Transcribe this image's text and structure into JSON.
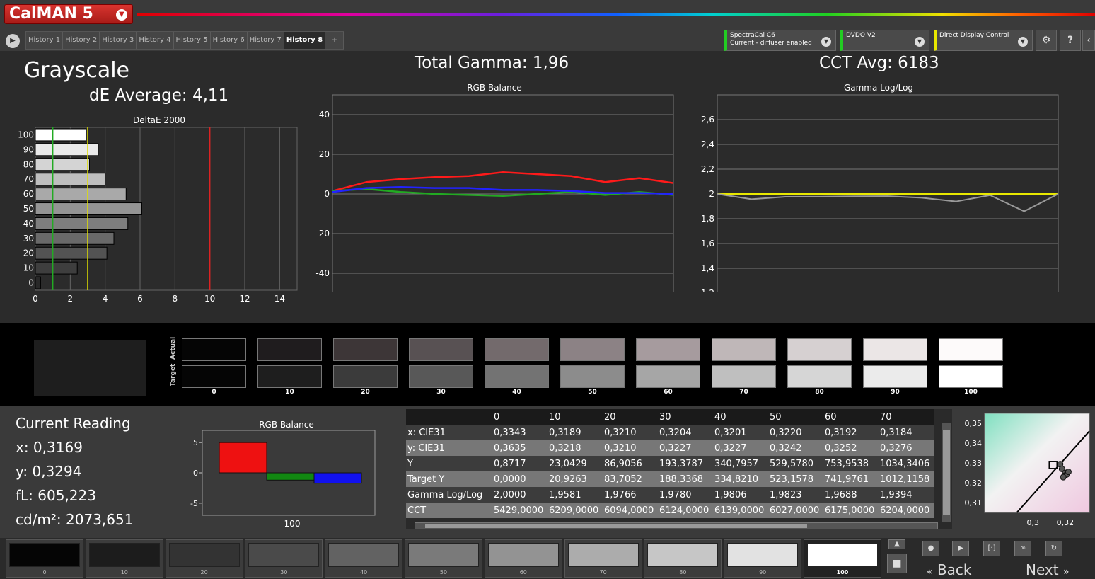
{
  "app": {
    "logo_text": "CalMAN 5"
  },
  "tabs": [
    {
      "label": "History 1"
    },
    {
      "label": "History 2"
    },
    {
      "label": "History 3"
    },
    {
      "label": "History 4"
    },
    {
      "label": "History 5"
    },
    {
      "label": "History 6"
    },
    {
      "label": "History 7"
    },
    {
      "label": "History 8",
      "active": true
    }
  ],
  "tab_add_label": "+",
  "devices": {
    "meter_line1": "SpectraCal C6",
    "meter_line2": "Current - diffuser enabled",
    "source": "DVDO V2",
    "display": "Direct Display Control"
  },
  "header": {
    "title": "Grayscale",
    "de_average": "dE Average: 4,11",
    "total_gamma": "Total Gamma: 1,96",
    "cct_avg": "CCT Avg: 6183"
  },
  "chart_data": [
    {
      "type": "bar",
      "title": "DeltaE 2000",
      "orientation": "horizontal",
      "categories": [
        "0",
        "10",
        "20",
        "30",
        "40",
        "50",
        "60",
        "70",
        "80",
        "90",
        "100"
      ],
      "values": [
        0.3,
        2.4,
        4.1,
        4.5,
        5.3,
        6.1,
        5.2,
        4.0,
        3.1,
        3.6,
        2.9
      ],
      "xlim": [
        0,
        15
      ],
      "xticks": [
        0,
        2,
        4,
        6,
        8,
        10,
        12,
        14
      ],
      "reference_lines": [
        {
          "value": 1,
          "color": "#22aa22"
        },
        {
          "value": 3,
          "color": "#e0e000"
        },
        {
          "value": 10,
          "color": "#dd2222"
        }
      ]
    },
    {
      "type": "line",
      "title": "RGB Balance",
      "x": [
        0,
        10,
        20,
        30,
        40,
        50,
        60,
        70,
        80,
        90,
        100
      ],
      "ylim": [
        -50,
        50
      ],
      "yticks": [
        40,
        20,
        0,
        -20,
        -40
      ],
      "series": [
        {
          "color": "#ff1a1a",
          "values": [
            1.5,
            6.0,
            7.5,
            8.5,
            9.0,
            11.0,
            10.0,
            9.0,
            6.0,
            8.0,
            5.5
          ]
        },
        {
          "color": "#22aa22",
          "values": [
            1.5,
            2.5,
            1.0,
            0.0,
            -0.5,
            -1.0,
            0.0,
            1.0,
            -0.5,
            1.0,
            -0.5
          ]
        },
        {
          "color": "#2222ff",
          "values": [
            1.0,
            3.0,
            3.5,
            3.0,
            3.0,
            2.0,
            2.0,
            1.5,
            0.5,
            0.5,
            0.0
          ]
        }
      ]
    },
    {
      "type": "line",
      "title": "Gamma Log/Log",
      "x": [
        0,
        10,
        20,
        30,
        40,
        50,
        60,
        70,
        80,
        90,
        100
      ],
      "ylim": [
        1.2,
        2.8
      ],
      "yticks": [
        "2,6",
        "2,4",
        "2,2",
        "2",
        "1,8",
        "1,6",
        "1,4",
        "1,2"
      ],
      "ytick_values": [
        2.6,
        2.4,
        2.2,
        2.0,
        1.8,
        1.6,
        1.4,
        1.2
      ],
      "series": [
        {
          "color": "#e8e800",
          "values": [
            2.0,
            2.0,
            2.0,
            2.0,
            2.0,
            2.0,
            2.0,
            2.0,
            2.0,
            2.0,
            2.0
          ]
        },
        {
          "color": "#9a9a9a",
          "values": [
            2.0,
            1.958,
            1.977,
            1.978,
            1.981,
            1.982,
            1.969,
            1.939,
            1.99,
            1.86,
            2.0
          ]
        }
      ]
    },
    {
      "type": "bar",
      "title": "RGB Balance",
      "categories": [
        "100"
      ],
      "series": [
        {
          "color": "#ee1111",
          "values": [
            5.0
          ]
        },
        {
          "color": "#118811",
          "values": [
            -1.2
          ]
        },
        {
          "color": "#1111ee",
          "values": [
            -1.7
          ]
        }
      ],
      "ylim": [
        -7,
        7
      ],
      "yticks": [
        5,
        0,
        -5
      ]
    },
    {
      "type": "scatter",
      "xticks": [
        "0,3",
        "0,32"
      ],
      "yticks": [
        "0,35",
        "0,34",
        "0,33",
        "0,32",
        "0,31"
      ],
      "xlim": [
        0.27,
        0.335
      ],
      "ylim": [
        0.305,
        0.355
      ],
      "target": {
        "x": 0.3127,
        "y": 0.329
      },
      "points": [
        {
          "x": 0.3169,
          "y": 0.3294
        },
        {
          "x": 0.318,
          "y": 0.327
        },
        {
          "x": 0.32,
          "y": 0.325
        },
        {
          "x": 0.3195,
          "y": 0.3235
        },
        {
          "x": 0.321,
          "y": 0.3242
        },
        {
          "x": 0.3188,
          "y": 0.3228
        },
        {
          "x": 0.322,
          "y": 0.3255
        }
      ]
    }
  ],
  "swatches": {
    "labels": [
      "0",
      "10",
      "20",
      "30",
      "40",
      "50",
      "60",
      "70",
      "80",
      "90",
      "100"
    ],
    "actual_label": "Actual",
    "target_label": "Target",
    "actual_colors": [
      "#050505",
      "#1f1c1e",
      "#3d3637",
      "#585153",
      "#736a6c",
      "#8c8285",
      "#a69b9e",
      "#bfb7b8",
      "#d6d0d1",
      "#ebe6e6",
      "#fdfafa"
    ],
    "target_colors": [
      "#050505",
      "#1e1e1e",
      "#3b3b3b",
      "#585858",
      "#737373",
      "#8c8c8c",
      "#a6a6a6",
      "#bfbfbf",
      "#d6d6d6",
      "#ebebeb",
      "#ffffff"
    ]
  },
  "current_reading": {
    "title": "Current Reading",
    "x": "x: 0,3169",
    "y": "y: 0,3294",
    "fl": "fL: 605,223",
    "cdm2": "cd/m²: 2073,651"
  },
  "table": {
    "columns": [
      "0",
      "10",
      "20",
      "30",
      "40",
      "50",
      "60",
      "70"
    ],
    "rows": [
      {
        "label": "x: CIE31",
        "values": [
          "0,3343",
          "0,3189",
          "0,3210",
          "0,3204",
          "0,3201",
          "0,3220",
          "0,3192",
          "0,3184"
        ]
      },
      {
        "label": "y: CIE31",
        "values": [
          "0,3635",
          "0,3218",
          "0,3210",
          "0,3227",
          "0,3227",
          "0,3242",
          "0,3252",
          "0,3276"
        ]
      },
      {
        "label": "Y",
        "values": [
          "0,8717",
          "23,0429",
          "86,9056",
          "193,3787",
          "340,7957",
          "529,5780",
          "753,9538",
          "1034,3406"
        ]
      },
      {
        "label": "Target Y",
        "values": [
          "0,0000",
          "20,9263",
          "83,7052",
          "188,3368",
          "334,8210",
          "523,1578",
          "741,9761",
          "1012,1158"
        ]
      },
      {
        "label": "Gamma Log/Log",
        "values": [
          "2,0000",
          "1,9581",
          "1,9766",
          "1,9780",
          "1,9806",
          "1,9823",
          "1,9688",
          "1,9394"
        ]
      },
      {
        "label": "CCT",
        "values": [
          "5429,0000",
          "6209,0000",
          "6094,0000",
          "6124,0000",
          "6139,0000",
          "6027,0000",
          "6175,0000",
          "6204,0000"
        ]
      }
    ]
  },
  "strip": {
    "labels": [
      "0",
      "10",
      "20",
      "30",
      "40",
      "50",
      "60",
      "70",
      "80",
      "90",
      "100"
    ],
    "colors": [
      "#050505",
      "#1c1c1c",
      "#333333",
      "#4a4a4a",
      "#626262",
      "#7a7a7a",
      "#939393",
      "#acacac",
      "#c6c6c6",
      "#e2e2e2",
      "#ffffff"
    ],
    "active": "100"
  },
  "nav": {
    "back": "Back",
    "next": "Next"
  }
}
